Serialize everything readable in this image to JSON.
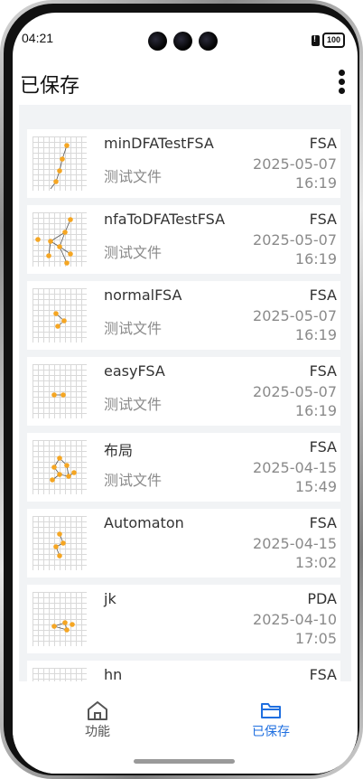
{
  "status_bar": {
    "time": "04:21",
    "battery": "100"
  },
  "header": {
    "title": "已保存"
  },
  "saved_items": [
    {
      "name": "minDFATestFSA",
      "description": "测试文件",
      "type": "FSA",
      "date": "2025-05-07",
      "time": "16:19"
    },
    {
      "name": "nfaToDFATestFSA",
      "description": "测试文件",
      "type": "FSA",
      "date": "2025-05-07",
      "time": "16:19"
    },
    {
      "name": "normalFSA",
      "description": "测试文件",
      "type": "FSA",
      "date": "2025-05-07",
      "time": "16:19"
    },
    {
      "name": "easyFSA",
      "description": "测试文件",
      "type": "FSA",
      "date": "2025-05-07",
      "time": "16:19"
    },
    {
      "name": "布局",
      "description": "测试文件",
      "type": "FSA",
      "date": "2025-04-15",
      "time": "15:49"
    },
    {
      "name": "Automaton",
      "description": "",
      "type": "FSA",
      "date": "2025-04-15",
      "time": "13:02"
    },
    {
      "name": "jk",
      "description": "",
      "type": "PDA",
      "date": "2025-04-10",
      "time": "17:05"
    },
    {
      "name": "hn",
      "description": "",
      "type": "FSA",
      "date": "",
      "time": ""
    }
  ],
  "bottom_nav": {
    "home_label": "功能",
    "saved_label": "已保存"
  },
  "colors": {
    "accent": "#1f6fe0",
    "node": "#f5a623",
    "content_bg": "#f1f3f5"
  },
  "icons": {
    "more": "more-vertical-icon",
    "home": "home-icon",
    "saved": "folder-icon"
  }
}
